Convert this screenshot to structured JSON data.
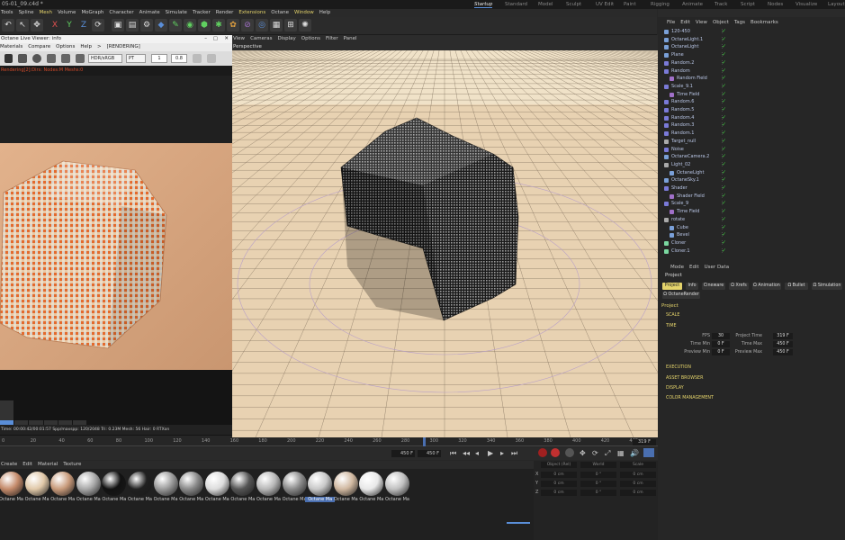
{
  "window_title": "05-01_09.c4d *",
  "layouts": [
    {
      "label": "Startup",
      "active": true
    },
    {
      "label": "Standard",
      "active": false
    },
    {
      "label": "Model",
      "active": false
    },
    {
      "label": "Sculpt",
      "active": false
    },
    {
      "label": "UV Edit",
      "active": false
    },
    {
      "label": "Paint",
      "active": false
    },
    {
      "label": "Rigging",
      "active": false
    },
    {
      "label": "Animate",
      "active": false
    },
    {
      "label": "Track",
      "active": false
    },
    {
      "label": "Script",
      "active": false
    },
    {
      "label": "Nodes",
      "active": false
    },
    {
      "label": "Visualize",
      "active": false
    },
    {
      "label": "Layout",
      "active": false
    }
  ],
  "main_menu": [
    {
      "label": "Tools",
      "hi": false
    },
    {
      "label": "Spline",
      "hi": false
    },
    {
      "label": "Mesh",
      "hi": true
    },
    {
      "label": "Volume",
      "hi": false
    },
    {
      "label": "MoGraph",
      "hi": false
    },
    {
      "label": "Character",
      "hi": false
    },
    {
      "label": "Animate",
      "hi": false
    },
    {
      "label": "Simulate",
      "hi": false
    },
    {
      "label": "Tracker",
      "hi": false
    },
    {
      "label": "Render",
      "hi": false
    },
    {
      "label": "Extensions",
      "hi": true
    },
    {
      "label": "Octane",
      "hi": false
    },
    {
      "label": "Window",
      "hi": true
    },
    {
      "label": "Help",
      "hi": false
    }
  ],
  "toolbar_axes": {
    "x": "X",
    "y": "Y",
    "z": "Z"
  },
  "render_window": {
    "title": "Octane Live Viewer: info",
    "menu": [
      "Options",
      "Filter",
      "Panel"
    ],
    "menu2": [
      "Materials",
      "Compare",
      "Options",
      "Help",
      ">",
      "[RENDERING]"
    ],
    "mode_select": "HDR/sRGB",
    "pt_select": "PT",
    "value1": "1",
    "value2": "0.8",
    "status": "Rendering[2]:Dirs: Nodes:M Meshs:0",
    "stat_line": "Time: 00:00:42/00:01:57  Spp/maxspp: 120/2048  Tri: 0.23M  Mesh: 56  Hair: 0  RTXon",
    "bottom_badge": "IRR"
  },
  "viewport": {
    "menu": [
      "View",
      "Cameras",
      "Display",
      "Options",
      "Filter",
      "Panel"
    ],
    "label": "Perspective"
  },
  "timeline": {
    "ticks": [
      "0",
      "20",
      "40",
      "60",
      "80",
      "100",
      "120",
      "140",
      "160",
      "180",
      "200",
      "220",
      "240",
      "260",
      "280",
      "300",
      "320",
      "340",
      "360",
      "380",
      "400",
      "420",
      "440"
    ],
    "current_frame": "319 F",
    "start_field": "0 F",
    "end_field": "450 F",
    "end_field2": "450 F"
  },
  "materials": {
    "menu": [
      "Create",
      "Edit",
      "Material",
      "Texture"
    ],
    "items": [
      {
        "label": "Octane Ma",
        "color": "#c48a6a",
        "selected": false
      },
      {
        "label": "Octane Ma",
        "color": "#e0c8a8",
        "selected": false
      },
      {
        "label": "Octane Ma",
        "color": "#c89a7a",
        "selected": false
      },
      {
        "label": "Octane Ma",
        "color": "#a8a8a8",
        "selected": false
      },
      {
        "label": "Octane Ma",
        "color": "#111111",
        "selected": false
      },
      {
        "label": "Octane Ma",
        "color": "#202020",
        "selected": false
      },
      {
        "label": "Octane Ma",
        "color": "#9a9a9a",
        "selected": false
      },
      {
        "label": "Octane Ma",
        "color": "#888888",
        "selected": false
      },
      {
        "label": "Octane Ma",
        "color": "#dcdcdc",
        "selected": false
      },
      {
        "label": "Octane Ma",
        "color": "#555555",
        "selected": false
      },
      {
        "label": "Octane Ma",
        "color": "#b8b8b8",
        "selected": false
      },
      {
        "label": "Octane Ma",
        "color": "#8a8a8a",
        "selected": false
      },
      {
        "label": "Octane Ma",
        "color": "#c8c8c8",
        "selected": true
      },
      {
        "label": "Octane Ma",
        "color": "#d0b8a0",
        "selected": false
      },
      {
        "label": "Octane Ma",
        "color": "#e8e8e8",
        "selected": false
      },
      {
        "label": "Octane Ma",
        "color": "#c0c0c0",
        "selected": false
      }
    ]
  },
  "coordinates": {
    "header": [
      "Position",
      "Size",
      "Rotation"
    ],
    "mode1": "Object (Rel)",
    "mode2": "World",
    "mode3": "Scale",
    "rows": [
      {
        "axis": "X",
        "pos": "0 cm",
        "size": "0 °",
        "rot": "0 cm"
      },
      {
        "axis": "Y",
        "pos": "0 cm",
        "size": "0 °",
        "rot": "0 cm"
      },
      {
        "axis": "Z",
        "pos": "0 cm",
        "size": "0 °",
        "rot": "0 cm"
      }
    ]
  },
  "object_manager": {
    "menu": [
      "File",
      "Edit",
      "View",
      "Object",
      "Tags",
      "Bookmarks"
    ],
    "rows": [
      {
        "name": "120-450",
        "indent": 1,
        "color": "#7aa0d8"
      },
      {
        "name": "OctaneLight.1",
        "indent": 1,
        "color": "#7aa0d8"
      },
      {
        "name": "OctaneLight",
        "indent": 1,
        "color": "#7aa0d8"
      },
      {
        "name": "Plane",
        "indent": 1,
        "color": "#7aa0d8"
      },
      {
        "name": "Random.2",
        "indent": 1,
        "color": "#7a7ad8"
      },
      {
        "name": "Random",
        "indent": 1,
        "color": "#7a7ad8"
      },
      {
        "name": "Random Field",
        "indent": 2,
        "color": "#a070c8"
      },
      {
        "name": "Scale_9.1",
        "indent": 1,
        "color": "#7a7ad8"
      },
      {
        "name": "Time Field",
        "indent": 2,
        "color": "#a070c8"
      },
      {
        "name": "Random.6",
        "indent": 1,
        "color": "#7a7ad8"
      },
      {
        "name": "Random.5",
        "indent": 1,
        "color": "#7a7ad8"
      },
      {
        "name": "Random.4",
        "indent": 1,
        "color": "#7a7ad8"
      },
      {
        "name": "Random.3",
        "indent": 1,
        "color": "#7a7ad8"
      },
      {
        "name": "Random.1",
        "indent": 1,
        "color": "#7a7ad8"
      },
      {
        "name": "Target_null",
        "indent": 1,
        "color": "#aaaaaa"
      },
      {
        "name": "Noise",
        "indent": 1,
        "color": "#7a7ad8"
      },
      {
        "name": "OctaneCamera.2",
        "indent": 1,
        "color": "#7aa0d8"
      },
      {
        "name": "Light_02",
        "indent": 1,
        "color": "#aaaaaa"
      },
      {
        "name": "OctaneLight",
        "indent": 2,
        "color": "#7aa0d8"
      },
      {
        "name": "OctaneSky.1",
        "indent": 1,
        "color": "#7aa0d8"
      },
      {
        "name": "Shader",
        "indent": 1,
        "color": "#7a7ad8"
      },
      {
        "name": "Shader Field",
        "indent": 2,
        "color": "#a070c8"
      },
      {
        "name": "Scale_9",
        "indent": 1,
        "color": "#7a7ad8"
      },
      {
        "name": "Time Field",
        "indent": 2,
        "color": "#a070c8"
      },
      {
        "name": "rotate",
        "indent": 1,
        "color": "#aaaaaa"
      },
      {
        "name": "Cube",
        "indent": 2,
        "color": "#7aa0d8"
      },
      {
        "name": "Bevel",
        "indent": 2,
        "color": "#7aa0d8"
      },
      {
        "name": "Cloner",
        "indent": 1,
        "color": "#7ad8a0"
      },
      {
        "name": "Cloner.1",
        "indent": 1,
        "color": "#7ad8a0"
      }
    ]
  },
  "attributes": {
    "menu": [
      "Mode",
      "Edit",
      "User Data"
    ],
    "mode": "Project",
    "tabs": [
      {
        "label": "Project",
        "active": true
      },
      {
        "label": "Info",
        "active": false
      },
      {
        "label": "Cineware",
        "active": false
      },
      {
        "label": "Ω Xrefs",
        "active": false
      },
      {
        "label": "Ω Animation",
        "active": false
      },
      {
        "label": "Ω Bullet",
        "active": false
      },
      {
        "label": "Ω Simulation",
        "active": false
      },
      {
        "label": "Ω OctaneRender",
        "active": false
      }
    ],
    "section_title": "Project",
    "sections": [
      "SCALE",
      "TIME",
      "EXECUTION",
      "ASSET BROWSER",
      "DISPLAY",
      "COLOR MANAGEMENT"
    ],
    "fields": {
      "fps_label": "FPS",
      "fps": "30",
      "project_time_label": "Project Time",
      "project_time": "319 F",
      "time_min_label": "Time Min",
      "time_min": "0 F",
      "time_max_label": "Time Max",
      "time_max": "450 F",
      "preview_min_label": "Preview Min",
      "preview_min": "0 F",
      "preview_max_label": "Preview Max",
      "preview_max": "450 F"
    }
  }
}
